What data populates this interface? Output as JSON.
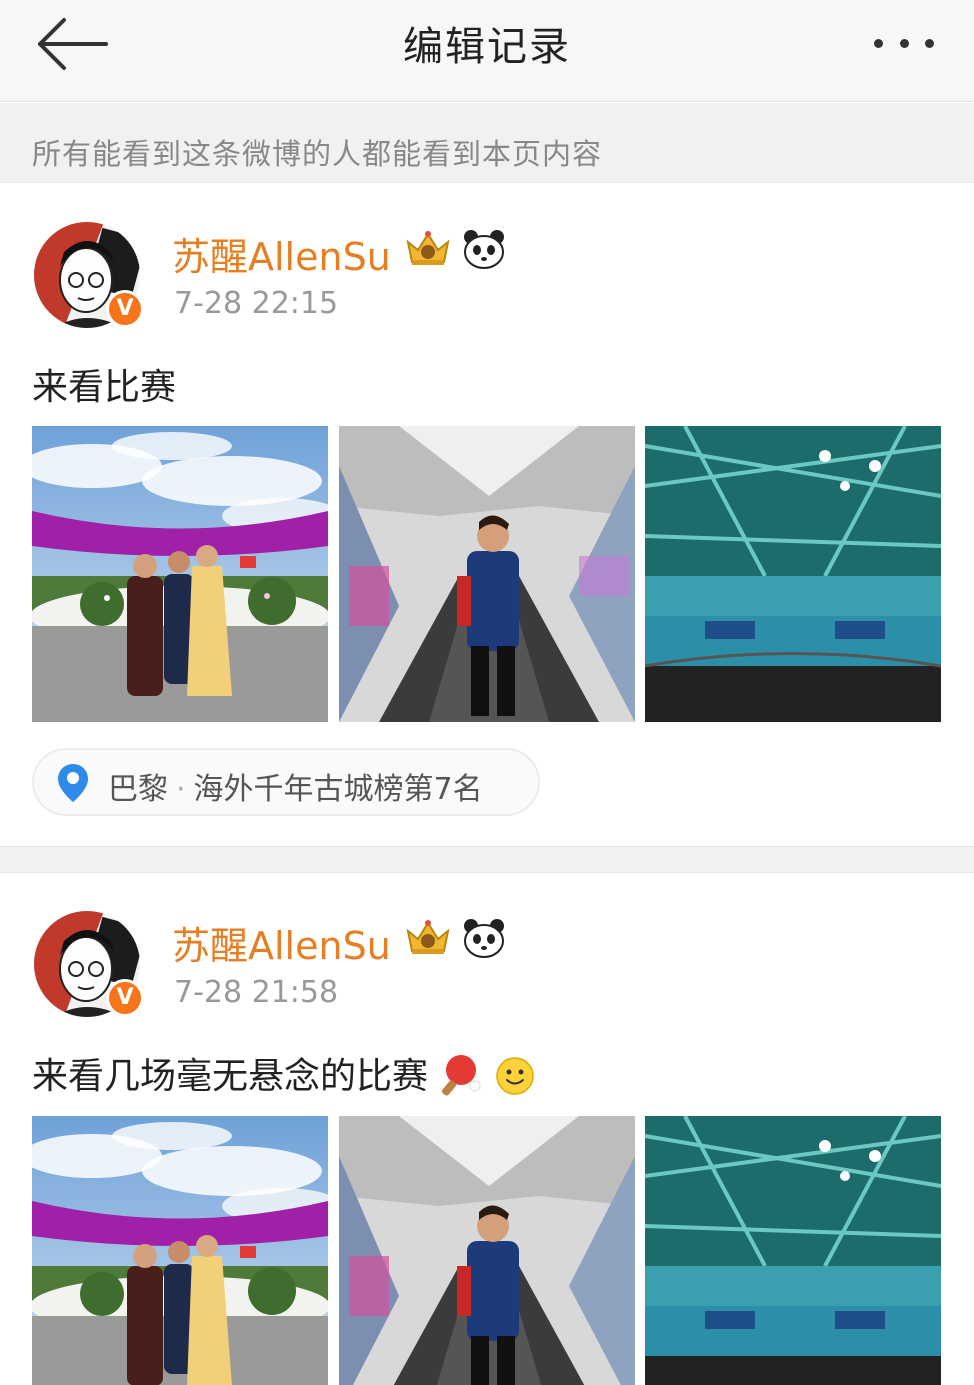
{
  "header": {
    "title": "编辑记录",
    "back_icon": "arrow-left-icon",
    "more_icon": "more-dots-icon"
  },
  "notice": {
    "text": "所有能看到这条微博的人都能看到本页内容"
  },
  "posts": [
    {
      "username": "苏醒AllenSu",
      "timestamp": "7-28 22:15",
      "text": "来看比赛",
      "badge": "V",
      "icons": [
        "crown-icon",
        "panda-icon"
      ],
      "photos": [
        "group-photo-outdoor",
        "escalator-selfie",
        "arena-panorama"
      ],
      "location": {
        "place": "巴黎",
        "separator": "·",
        "ranking": "海外千年古城榜第7名"
      }
    },
    {
      "username": "苏醒AllenSu",
      "timestamp": "7-28 21:58",
      "text": "来看几场毫无悬念的比赛",
      "badge": "V",
      "icons": [
        "crown-icon",
        "panda-icon"
      ],
      "emojis": [
        "ping-pong-icon",
        "smile-icon"
      ],
      "photos": [
        "group-photo-outdoor",
        "escalator-selfie",
        "arena-panorama"
      ]
    }
  ],
  "colors": {
    "username": "#e67e22",
    "verified_badge": "#f8741b",
    "location_pin": "#2e8bea"
  }
}
